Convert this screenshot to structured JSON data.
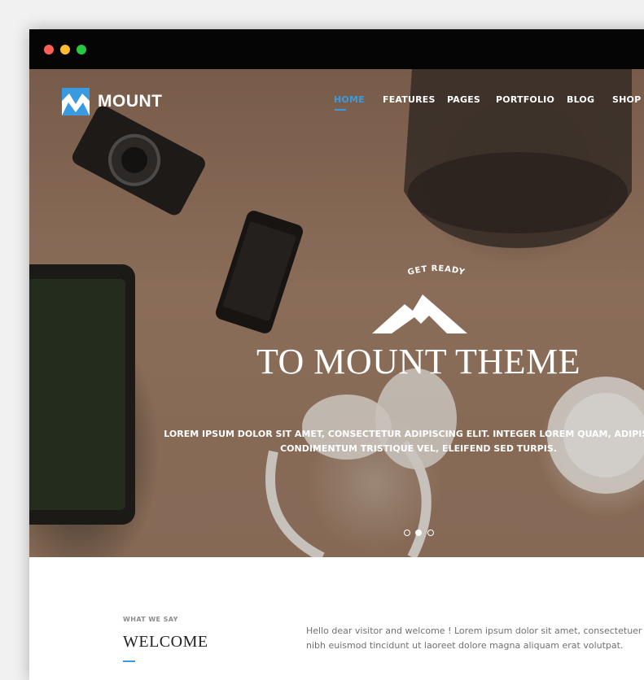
{
  "brand": {
    "name": "MOUNT"
  },
  "nav": {
    "items": [
      {
        "label": "HOME",
        "active": true
      },
      {
        "label": "FEATURES",
        "active": false
      },
      {
        "label": "PAGES",
        "active": false
      },
      {
        "label": "PORTFOLIO",
        "active": false
      },
      {
        "label": "BLOG",
        "active": false
      },
      {
        "label": "SHOP",
        "active": false
      }
    ]
  },
  "hero": {
    "eyebrow": "GET READY",
    "headline": "TO MOUNT THEME",
    "subline_1": "LOREM IPSUM DOLOR SIT AMET, CONSECTETUR ADIPISCING ELIT. INTEGER LOREM QUAM, ADIPISCING",
    "subline_2": "CONDIMENTUM TRISTIQUE VEL, ELEIFEND SED TURPIS.",
    "slides": {
      "count": 3,
      "active_index": 1
    }
  },
  "welcome": {
    "eyebrow": "WHAT WE SAY",
    "title": "WELCOME",
    "body_1": "Hello dear visitor and welcome ! Lorem ipsum dolor sit amet, consectetuer adipiscing el",
    "body_2": "nibh euismod tincidunt ut laoreet dolore magna aliquam erat volutpat."
  },
  "colors": {
    "accent": "#3a9ae0",
    "titlebar": "#050505",
    "window_controls": [
      "#ff5f57",
      "#febc2e",
      "#28c840"
    ]
  },
  "icons": {
    "logo": "mountain-logo-icon",
    "hero": "mountain-icon"
  }
}
